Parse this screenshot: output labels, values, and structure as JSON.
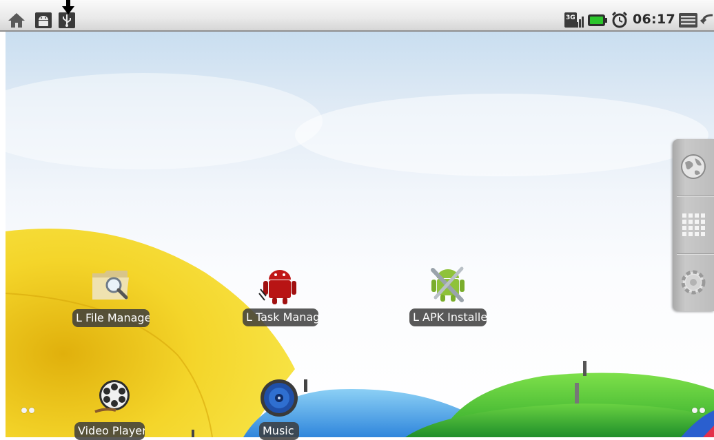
{
  "status_bar": {
    "time": "06:17",
    "network_badge": "3G",
    "left_icons": [
      "home-icon",
      "android-debug-icon",
      "usb-icon"
    ],
    "right_icons": [
      "3g-signal-icon",
      "battery-icon",
      "alarm-clock-icon",
      "menu-icon",
      "back-icon"
    ]
  },
  "shortcuts": [
    {
      "label": "L File Manage",
      "icon": "folder-search-icon"
    },
    {
      "label": "L Task Manag",
      "icon": "task-manager-icon"
    },
    {
      "label": "L APK Installe",
      "icon": "apk-installer-icon"
    },
    {
      "label": "Video Player",
      "icon": "film-reel-icon"
    },
    {
      "label": "Music",
      "icon": "speaker-icon"
    }
  ],
  "side_bar": {
    "buttons": [
      "browser-globe-icon",
      "app-drawer-grid-icon",
      "settings-gear-icon"
    ]
  },
  "colors": {
    "umbrella_yellow": "#f2d21a",
    "umbrella_blue": "#3b8fe0",
    "umbrella_green": "#48c23a",
    "label_bg": "#3c3c3c"
  }
}
